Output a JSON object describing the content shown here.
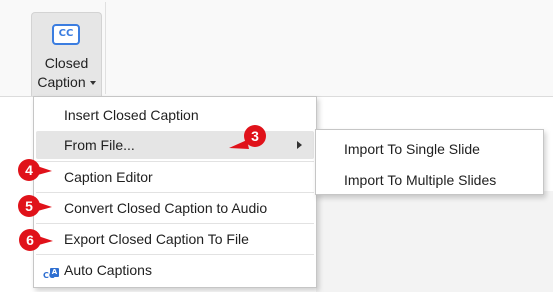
{
  "ribbon": {
    "closed_caption_button": {
      "icon_text": "CC",
      "label_line1": "Closed",
      "label_line2": "Caption"
    }
  },
  "menu": {
    "items": [
      {
        "label": "Insert Closed Caption"
      },
      {
        "label": "From File..."
      },
      {
        "label": "Caption Editor"
      },
      {
        "label": "Convert Closed Caption to Audio"
      },
      {
        "label": "Export Closed Caption To File"
      },
      {
        "label": "Auto Captions"
      }
    ],
    "auto_captions_icon": {
      "top": "CC",
      "badge": "A"
    }
  },
  "submenu": {
    "items": [
      {
        "label": "Import To Single Slide"
      },
      {
        "label": "Import To Multiple Slides"
      }
    ]
  },
  "annotations": [
    {
      "number": "3"
    },
    {
      "number": "4"
    },
    {
      "number": "5"
    },
    {
      "number": "6"
    }
  ],
  "colors": {
    "accent_blue": "#3b7de0",
    "annotation_red": "#e0121a",
    "highlight": "#e5e5e5"
  }
}
